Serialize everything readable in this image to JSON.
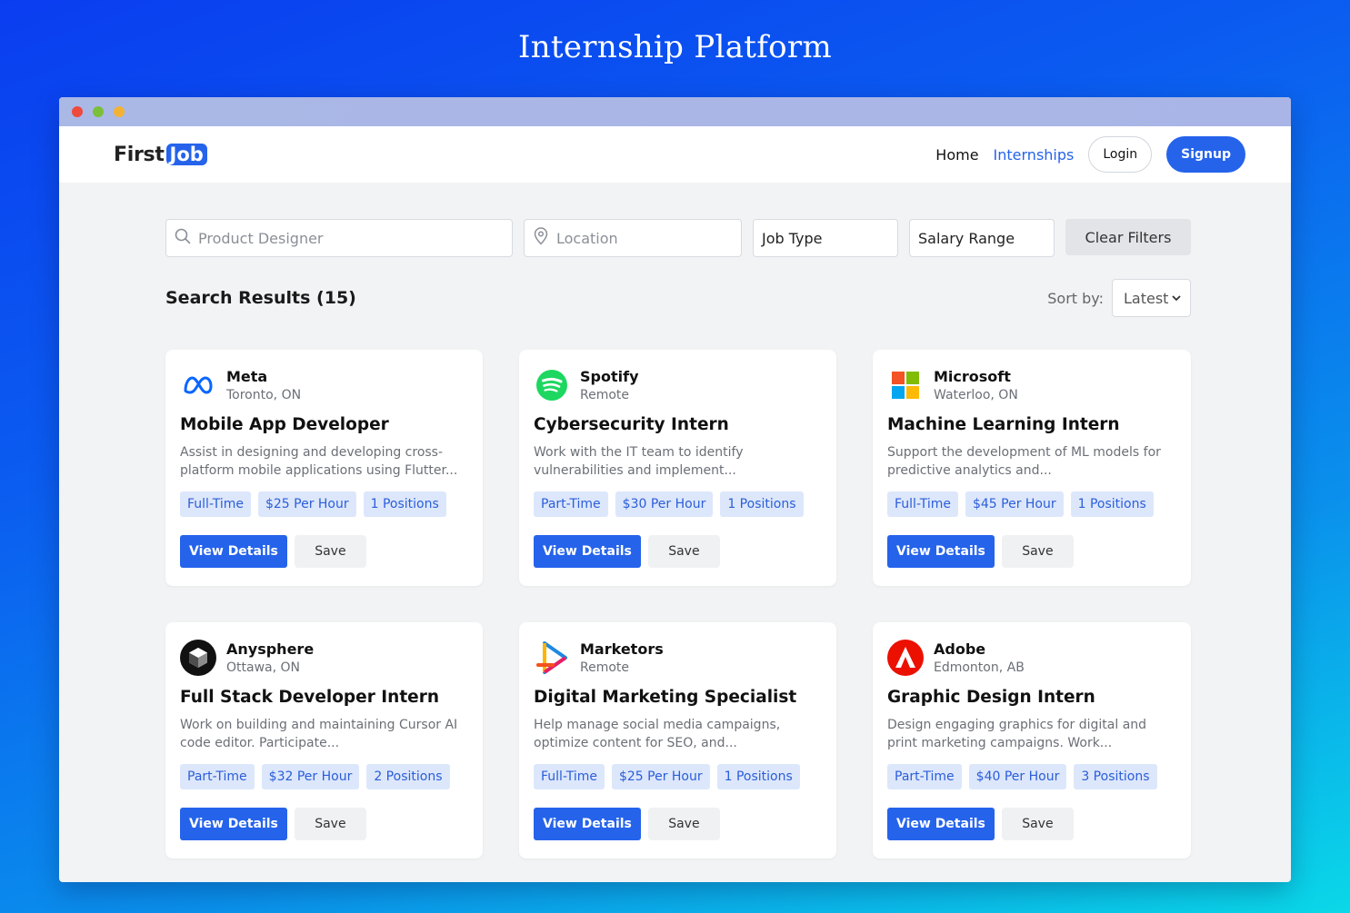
{
  "page_title": "Internship Platform",
  "nav": {
    "logo_first": "First",
    "logo_job": "Job",
    "links": [
      {
        "label": "Home",
        "active": false
      },
      {
        "label": "Internships",
        "active": true
      }
    ],
    "login_label": "Login",
    "signup_label": "Signup"
  },
  "filters": {
    "search_placeholder": "Product Designer",
    "location_placeholder": "Location",
    "job_type_value": "Job Type",
    "salary_value": "Salary Range",
    "clear_label": "Clear Filters"
  },
  "results": {
    "title": "Search Results (15)",
    "sort_label": "Sort by:",
    "sort_value": "Latest"
  },
  "cards": [
    {
      "company": "Meta",
      "location": "Toronto, ON",
      "logo": "meta-logo-icon",
      "role": "Mobile App Developer",
      "description": "Assist in designing and developing cross-platform mobile applications using Flutter...",
      "tags": [
        "Full-Time",
        "$25 Per Hour",
        "1 Positions"
      ]
    },
    {
      "company": "Spotify",
      "location": "Remote",
      "logo": "spotify-logo-icon",
      "role": "Cybersecurity Intern",
      "description": "Work with the IT team to identify vulnerabilities and implement...",
      "tags": [
        "Part-Time",
        "$30 Per Hour",
        "1 Positions"
      ]
    },
    {
      "company": "Microsoft",
      "location": "Waterloo, ON",
      "logo": "microsoft-logo-icon",
      "role": "Machine Learning Intern",
      "description": "Support the development of ML models for predictive analytics and...",
      "tags": [
        "Full-Time",
        "$45 Per Hour",
        "1 Positions"
      ]
    },
    {
      "company": "Anysphere",
      "location": "Ottawa, ON",
      "logo": "anysphere-logo-icon",
      "role": "Full Stack Developer Intern",
      "description": "Work on building and maintaining Cursor AI code editor. Participate...",
      "tags": [
        "Part-Time",
        "$32 Per Hour",
        "2 Positions"
      ]
    },
    {
      "company": "Marketors",
      "location": "Remote",
      "logo": "marketors-logo-icon",
      "role": "Digital Marketing Specialist",
      "description": "Help manage social media campaigns, optimize content for SEO, and...",
      "tags": [
        "Full-Time",
        "$25 Per Hour",
        "1 Positions"
      ]
    },
    {
      "company": "Adobe",
      "location": "Edmonton, AB",
      "logo": "adobe-logo-icon",
      "role": "Graphic Design Intern",
      "description": "Design engaging graphics for digital and print marketing campaigns. Work...",
      "tags": [
        "Part-Time",
        "$40 Per Hour",
        "3 Positions"
      ]
    }
  ],
  "card_actions": {
    "view_label": "View Details",
    "save_label": "Save"
  },
  "colors": {
    "accent": "#2563eb",
    "tag_bg": "#dde7fb",
    "tag_text": "#2a5ed9"
  }
}
